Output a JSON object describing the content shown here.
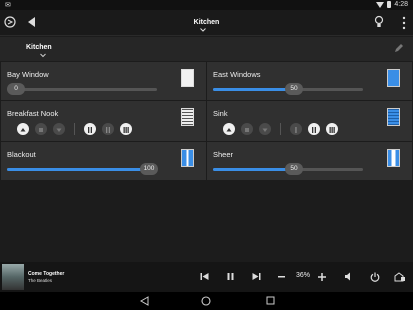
{
  "statusbar": {
    "time": "4:28"
  },
  "header": {
    "title": "Kitchen"
  },
  "room": {
    "name": "Kitchen"
  },
  "shades": [
    {
      "name": "Bay Window",
      "level": "0"
    },
    {
      "name": "East Windows",
      "level": "50"
    },
    {
      "name": "Breakfast Nook"
    },
    {
      "name": "Sink"
    },
    {
      "name": "Blackout",
      "level": "100"
    },
    {
      "name": "Sheer",
      "level": "50"
    }
  ],
  "media": {
    "song": "Come Together",
    "artist": "The Beatles",
    "volume": "36%"
  },
  "colors": {
    "accent": "#3a8ee6",
    "background": "#1c1c1c",
    "card": "#303030"
  }
}
